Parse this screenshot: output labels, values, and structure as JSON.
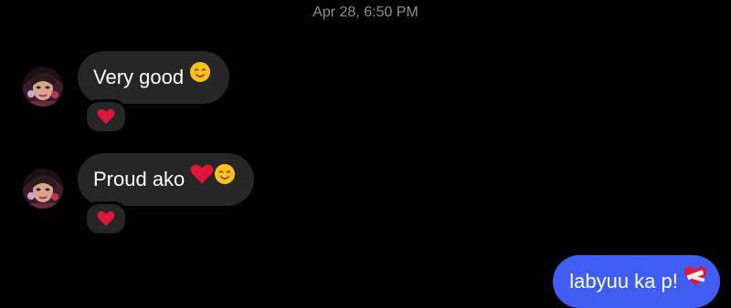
{
  "timestamp": "Apr 28, 6:50 PM",
  "messages": [
    {
      "direction": "incoming",
      "text": "Very good",
      "emoji": [
        "smiling-face"
      ],
      "reaction": "red-heart"
    },
    {
      "direction": "incoming",
      "text": "Proud ako",
      "emoji": [
        "red-heart",
        "smiling-face"
      ],
      "reaction": "red-heart"
    },
    {
      "direction": "outgoing",
      "text": "labyuu ka p!",
      "emoji": [
        "bandaged-heart"
      ]
    }
  ],
  "colors": {
    "background": "#000000",
    "incoming_bubble": "#262626",
    "outgoing_bubble": "#3f5df0",
    "timestamp_text": "#8e8e93",
    "message_text": "#ffffff"
  }
}
